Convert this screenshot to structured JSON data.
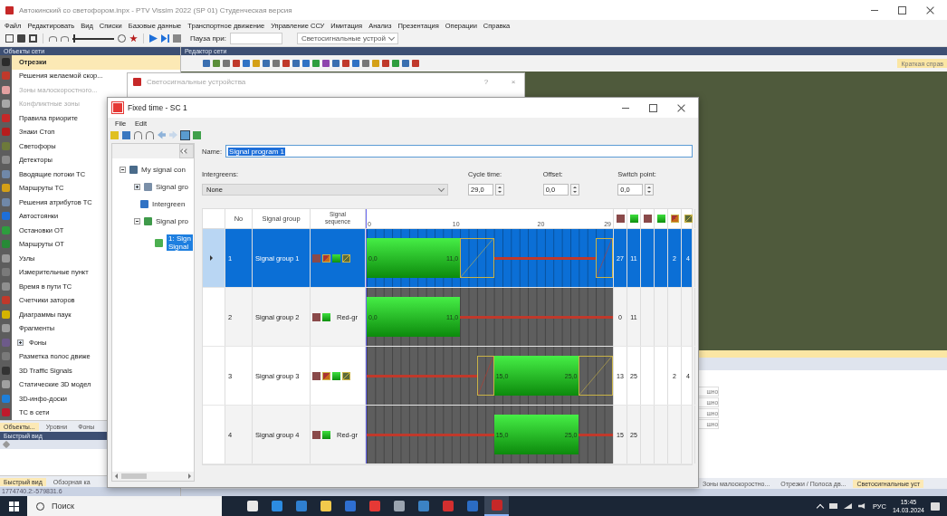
{
  "app": {
    "title": "Автокинский со светофором.inpx - PTV Vissim 2022 (SP 01) Студенческая версия",
    "menu": [
      "Файл",
      "Редактировать",
      "Вид",
      "Списки",
      "Базовые данные",
      "Транспортное движение",
      "Управление ССУ",
      "Имитация",
      "Анализ",
      "Презентация",
      "Операции",
      "Справка"
    ],
    "toolbar": {
      "speed_slider": {
        "level": 0.02
      },
      "pause_label": "Пауза при:",
      "view_select": "Светосигнальные устрой"
    }
  },
  "sidebar": {
    "title": "Объекты сети",
    "items": [
      {
        "label": "Отрезки",
        "selected": true,
        "disabled": false,
        "color": "#2b2b2b"
      },
      {
        "label": "Решения желаемой скор...",
        "selected": false,
        "disabled": false,
        "color": "#c0392b"
      },
      {
        "label": "Зоны малоскоростного...",
        "selected": false,
        "disabled": true,
        "color": "#e3a1a1"
      },
      {
        "label": "Конфликтные зоны",
        "selected": false,
        "disabled": true,
        "color": "#a8a8a8"
      },
      {
        "label": "Правила приорите",
        "selected": false,
        "disabled": false,
        "color": "#c62828"
      },
      {
        "label": "Знаки Стоп",
        "selected": false,
        "disabled": false,
        "color": "#b71c1c"
      },
      {
        "label": "Светофоры",
        "selected": false,
        "disabled": false,
        "color": "#6d7a3a"
      },
      {
        "label": "Детекторы",
        "selected": false,
        "disabled": false,
        "color": "#8c8c8c"
      },
      {
        "label": "Вводящие потоки ТС",
        "selected": false,
        "disabled": false,
        "color": "#7088a8"
      },
      {
        "label": "Маршруты ТС",
        "selected": false,
        "disabled": false,
        "color": "#d4a017"
      },
      {
        "label": "Решения атрибутов ТС",
        "selected": false,
        "disabled": false,
        "color": "#7088a8"
      },
      {
        "label": "Автостоянки",
        "selected": false,
        "disabled": false,
        "color": "#1e6fd9"
      },
      {
        "label": "Остановки ОТ",
        "selected": false,
        "disabled": false,
        "color": "#2e9e3e"
      },
      {
        "label": "Маршруты ОТ",
        "selected": false,
        "disabled": false,
        "color": "#278a36"
      },
      {
        "label": "Узлы",
        "selected": false,
        "disabled": false,
        "color": "#9a9a9a"
      },
      {
        "label": "Измерительные пункт",
        "selected": false,
        "disabled": false,
        "color": "#7a7a7a"
      },
      {
        "label": "Время в пути ТС",
        "selected": false,
        "disabled": false,
        "color": "#8f8f8f"
      },
      {
        "label": "Счетчики заторов",
        "selected": false,
        "disabled": false,
        "color": "#c0392b"
      },
      {
        "label": "Диаграммы паук",
        "selected": false,
        "disabled": false,
        "color": "#d4b400"
      },
      {
        "label": "Фрагменты",
        "selected": false,
        "disabled": false,
        "color": "#9e9e9e"
      },
      {
        "label": "Фоны",
        "selected": false,
        "disabled": false,
        "color": "#6d5a8a",
        "expanded": false
      },
      {
        "label": "Разметка полос движе",
        "selected": false,
        "disabled": false,
        "color": "#7a7a7a"
      },
      {
        "label": "3D Traffic Signals",
        "selected": false,
        "disabled": false,
        "color": "#333333"
      },
      {
        "label": "Статические 3D модел",
        "selected": false,
        "disabled": false,
        "color": "#a0a0a0"
      },
      {
        "label": "3D-инфо-доски",
        "selected": false,
        "disabled": false,
        "color": "#1e7fd9"
      },
      {
        "label": "ТС в сети",
        "selected": false,
        "disabled": false,
        "color": "#c0192b"
      }
    ],
    "tabs": [
      {
        "label": "Объекты...",
        "selected": true
      },
      {
        "label": "Уровни",
        "selected": false
      },
      {
        "label": "Фоны",
        "selected": false
      }
    ]
  },
  "quick_view": {
    "title": "Быстрый вид",
    "tabs": [
      {
        "label": "Быстрый вид",
        "selected": true
      },
      {
        "label": "Обзорная ка",
        "selected": false
      }
    ]
  },
  "coordinates": "1774740.2:-579831.6",
  "editor": {
    "title": "Редактор сети",
    "help_tab": "Краткая справ",
    "list_cells": [
      "шно",
      "шно",
      "шно",
      "шно"
    ],
    "tabs": [
      {
        "label": "Зоны малоскоростно...",
        "selected": false
      },
      {
        "label": "Отрезки / Полоса дв...",
        "selected": false
      },
      {
        "label": "Светосигнальные уст",
        "selected": true
      }
    ]
  },
  "back_dialog": {
    "title": "Светосигнальные устройства",
    "help": "?",
    "close": "×"
  },
  "fixed_time": {
    "title": "Fixed time - SC 1",
    "menu": [
      "File",
      "Edit"
    ],
    "tree": [
      {
        "label": "My signal con",
        "kind": "controller",
        "expanded": true,
        "children": [
          {
            "label": "Signal gro",
            "kind": "groups",
            "expanded": false
          },
          {
            "label": "Intergreen",
            "kind": "intergreens"
          },
          {
            "label": "Signal pro",
            "kind": "programs",
            "expanded": true,
            "children": [
              {
                "lines": [
                  "1: Sign",
                  "Signal"
                ],
                "kind": "program",
                "selected": true
              }
            ]
          }
        ]
      }
    ],
    "name_label": "Name:",
    "name_value": "Signal program 1",
    "intergreens_label": "Intergreens:",
    "intergreens_value": "None",
    "cycle_label": "Cycle time:",
    "cycle_value": "29,0",
    "offset_label": "Offset:",
    "offset_value": "0,0",
    "switch_label": "Switch point:",
    "switch_value": "0,0",
    "table": {
      "columns": [
        "No",
        "Signal group",
        "Signal",
        "sequence"
      ],
      "axis_ticks": [
        "0",
        "10",
        "20",
        "29"
      ],
      "extra_columns": [
        {
          "kind": "red"
        },
        {
          "kind": "green"
        },
        {
          "kind": "red"
        },
        {
          "kind": "green"
        },
        {
          "kind": "red-amber"
        },
        {
          "kind": "amber"
        }
      ],
      "rows": [
        {
          "no": "1",
          "group": "Signal group 1",
          "selected": true,
          "sequence": [
            {
              "kind": "red"
            },
            {
              "kind": "red-amber"
            },
            {
              "kind": "green"
            },
            {
              "kind": "amber"
            }
          ],
          "green_start": "0,0",
          "green_end_label": "11,0",
          "red_end": "27",
          "green_end": "11",
          "red_amber": "2",
          "amber": "4"
        },
        {
          "no": "2",
          "group": "Signal group 2",
          "selected": false,
          "sequence": [
            {
              "kind": "red"
            },
            {
              "kind": "green"
            }
          ],
          "sequence_label": "Red-gr",
          "green_start": "0,0",
          "green_end_label": "11,0",
          "red_end": "0",
          "green_end": "11"
        },
        {
          "no": "3",
          "group": "Signal group 3",
          "selected": false,
          "sequence": [
            {
              "kind": "red"
            },
            {
              "kind": "red-amber"
            },
            {
              "kind": "green"
            },
            {
              "kind": "amber"
            }
          ],
          "green_start": "15,0",
          "green_end_label": "25,0",
          "red_end": "13",
          "green_end": "25",
          "red_amber": "2",
          "amber": "4"
        },
        {
          "no": "4",
          "group": "Signal group 4",
          "selected": false,
          "sequence": [
            {
              "kind": "red"
            },
            {
              "kind": "green"
            }
          ],
          "sequence_label": "Red-gr",
          "green_start": "15,0",
          "green_end_label": "25,0",
          "red_end": "15",
          "green_end": "25"
        }
      ]
    }
  },
  "taskbar": {
    "search": "Поиск",
    "apps": [
      {
        "color": "#e8e8e8",
        "selected": false
      },
      {
        "color": "#2c8be0",
        "selected": false
      },
      {
        "color": "#2f7fd0",
        "selected": false
      },
      {
        "color": "#f2c94c",
        "selected": false
      },
      {
        "color": "#2f6fd1",
        "selected": false
      },
      {
        "color": "#e53935",
        "selected": false
      },
      {
        "color": "#9aa4b0",
        "selected": false
      },
      {
        "color": "#3b82c4",
        "selected": false
      },
      {
        "color": "#d32f2f",
        "selected": false
      },
      {
        "color": "#2b6cc4",
        "selected": false
      },
      {
        "color": "#c62828",
        "selected": true
      }
    ],
    "lang": "РУС",
    "time": "15:45",
    "date": "14.03.2024"
  }
}
